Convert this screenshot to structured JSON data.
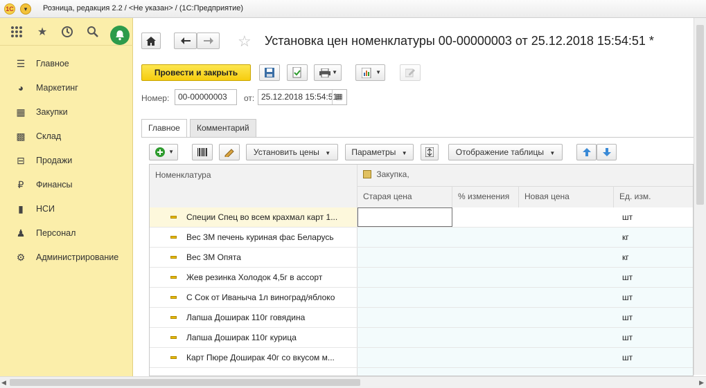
{
  "window": {
    "logo": "1С",
    "title": "Розница, редакция 2.2 / <Не указан> / (1С:Предприятие)"
  },
  "sidebar": {
    "top_icons": [
      "apps-grid-icon",
      "star-icon",
      "history-icon",
      "search-icon",
      "bell-icon"
    ],
    "items": [
      {
        "label": "Главное",
        "icon": "menu-lines-icon"
      },
      {
        "label": "Маркетинг",
        "icon": "pie-chart-icon"
      },
      {
        "label": "Закупки",
        "icon": "cart-icon"
      },
      {
        "label": "Склад",
        "icon": "warehouse-icon"
      },
      {
        "label": "Продажи",
        "icon": "basket-icon"
      },
      {
        "label": "Финансы",
        "icon": "ruble-icon"
      },
      {
        "label": "НСИ",
        "icon": "book-icon"
      },
      {
        "label": "Персонал",
        "icon": "person-icon"
      },
      {
        "label": "Администрирование",
        "icon": "gear-icon"
      }
    ]
  },
  "header": {
    "title": "Установка цен номенклатуры 00-00000003 от 25.12.2018 15:54:51 *"
  },
  "toolbar": {
    "post_close_label": "Провести и закрыть"
  },
  "form": {
    "number_label": "Номер:",
    "number_value": "00-00000003",
    "date_label": "от:",
    "date_value": "25.12.2018 15:54:51"
  },
  "tabs": [
    {
      "label": "Главное",
      "active": true
    },
    {
      "label": "Комментарий",
      "active": false
    }
  ],
  "table_toolbar": {
    "set_prices_label": "Установить цены",
    "params_label": "Параметры",
    "display_label": "Отображение таблицы"
  },
  "table": {
    "col_item": "Номенклатура",
    "group_label": "Закупка,",
    "col_old": "Старая цена",
    "col_pct": "% изменения",
    "col_new": "Новая цена",
    "col_unit": "Ед. изм.",
    "rows": [
      {
        "name": "Специи Спец во всем крахмал карт 1...",
        "unit": "шт"
      },
      {
        "name": "Вес  ЗМ печень куриная  фас Беларусь",
        "unit": "кг"
      },
      {
        "name": "Вес  ЗМ Опята",
        "unit": "кг"
      },
      {
        "name": "Жев резинка Холодок 4,5г в ассорт",
        "unit": "шт"
      },
      {
        "name": "С Сок от Иваныча 1л виноград/яблоко",
        "unit": "шт"
      },
      {
        "name": "Лапша Доширак 110г говядина",
        "unit": "шт"
      },
      {
        "name": "Лапша Доширак 110г курица",
        "unit": "шт"
      },
      {
        "name": "Карт Пюре Доширак 40г со вкусом м...",
        "unit": "шт"
      }
    ]
  }
}
